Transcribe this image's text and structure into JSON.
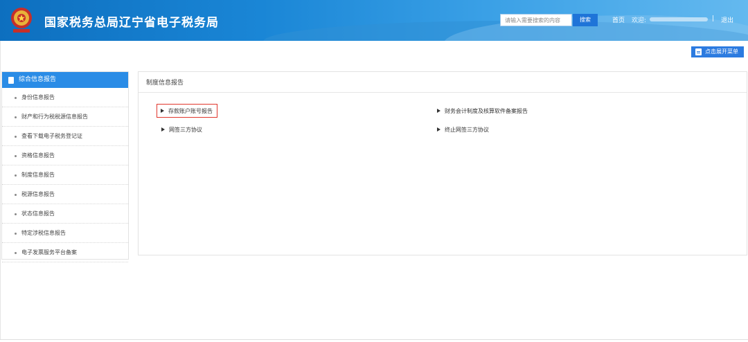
{
  "header": {
    "title": "国家税务总局辽宁省电子税务局",
    "search_placeholder": "请输入需要搜索的内容",
    "search_button": "搜索",
    "home": "首页",
    "welcome": "欢迎:",
    "separator": "|",
    "logout": "退出",
    "brand_color": "#1a86d6"
  },
  "toolbar": {
    "expand_menu": "点击展开菜单",
    "expand_icon": "menu-icon"
  },
  "sidebar": {
    "header": "综合信息报告",
    "header_icon": "document-icon",
    "items": [
      {
        "label": "身份信息报告"
      },
      {
        "label": "财产和行为税税源信息报告"
      },
      {
        "label": "查看下载电子税务登记证"
      },
      {
        "label": "资格信息报告"
      },
      {
        "label": "制度信息报告"
      },
      {
        "label": "税源信息报告"
      },
      {
        "label": "状态信息报告"
      },
      {
        "label": "特定涉税信息报告"
      },
      {
        "label": "电子发票服务平台备案"
      }
    ]
  },
  "main": {
    "title": "制度信息报告",
    "links": [
      {
        "label": "存款账户账号报告",
        "highlighted": true
      },
      {
        "label": "财务会计制度及核算软件备案报告"
      },
      {
        "label": "网签三方协议"
      },
      {
        "label": "终止网签三方协议"
      }
    ],
    "highlight_color": "#e0352b"
  }
}
